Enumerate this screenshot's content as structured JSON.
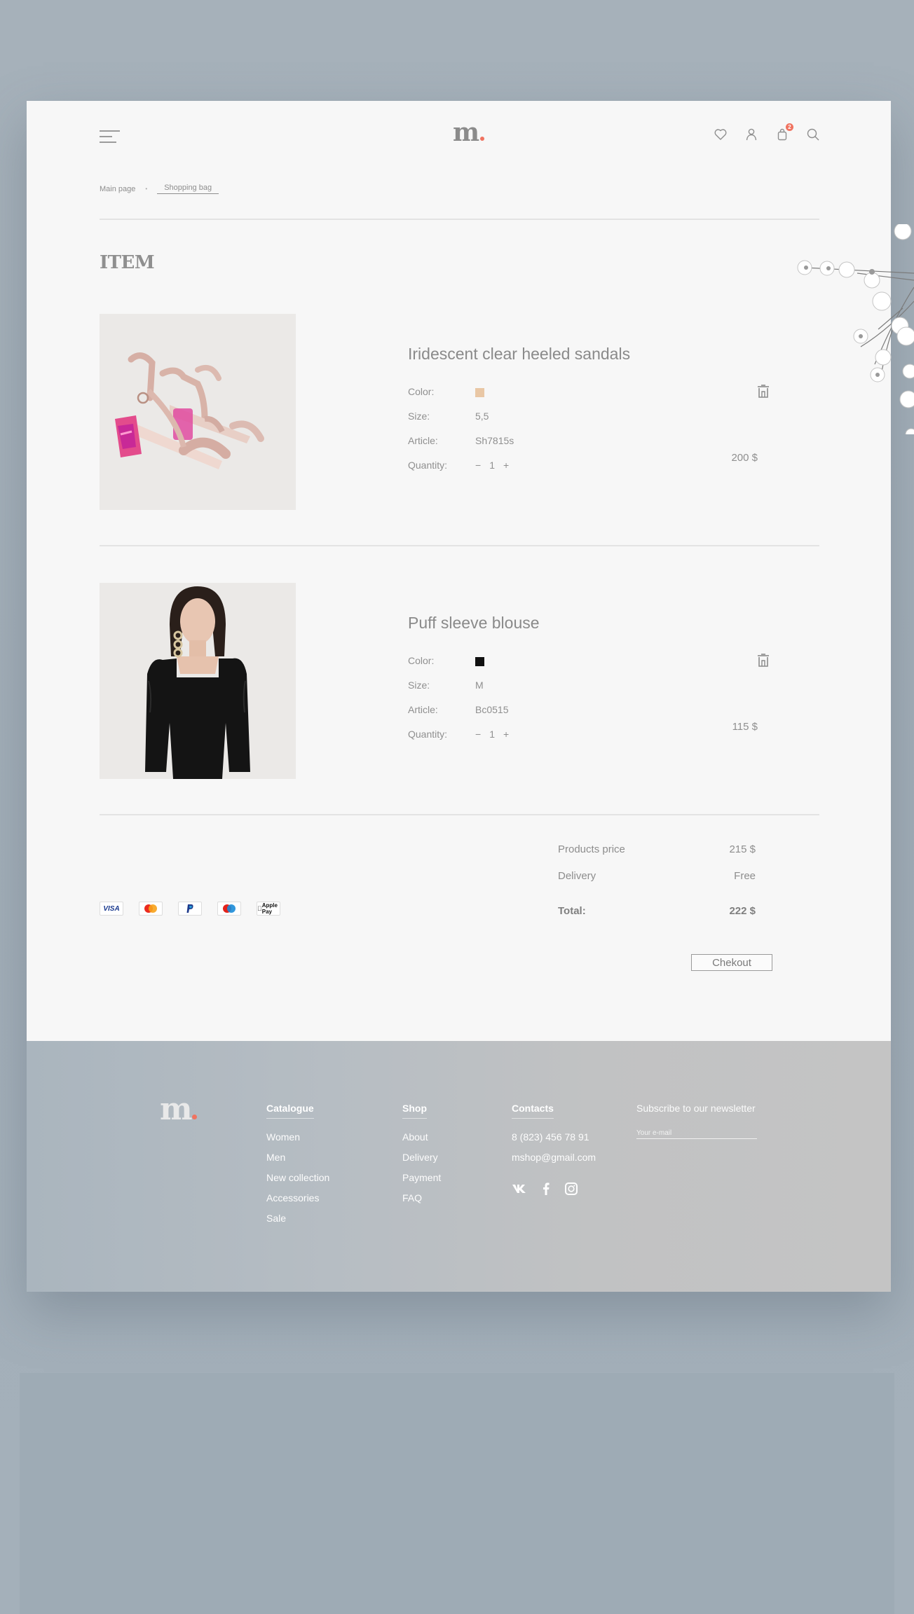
{
  "header": {
    "logo": "m",
    "cart_count": "2",
    "icons": [
      "menu-icon",
      "heart-icon",
      "user-icon",
      "bag-icon",
      "search-icon"
    ]
  },
  "breadcrumb": {
    "items": [
      "Main page",
      "Shopping bag"
    ],
    "separator": "•"
  },
  "section_title": "ITEM",
  "labels": {
    "color": "Color:",
    "size": "Size:",
    "article": "Article:",
    "quantity": "Quantity:",
    "minus": "−",
    "plus": "+"
  },
  "products": [
    {
      "name": "Iridescent clear heeled sandals",
      "color_hex": "#e9c7a5",
      "size": "5,5",
      "article": "Sh7815s",
      "quantity": "1",
      "price": "200 $"
    },
    {
      "name": "Puff sleeve blouse",
      "color_hex": "#111111",
      "size": "M",
      "article": "Bc0515",
      "quantity": "1",
      "price": "115 $"
    }
  ],
  "payment_methods": [
    "VISA",
    "Mastercard",
    "PayPal",
    "Maestro",
    "Apple Pay"
  ],
  "summary": {
    "products_price_label": "Products price",
    "products_price": "215 $",
    "delivery_label": "Delivery",
    "delivery": "Free",
    "total_label": "Total:",
    "total": "222 $",
    "checkout_label": "Chekout"
  },
  "footer": {
    "logo": "m",
    "catalogue": {
      "title": "Catalogue",
      "items": [
        "Women",
        "Men",
        "New collection",
        "Accessories",
        "Sale"
      ]
    },
    "shop": {
      "title": "Shop",
      "items": [
        "About",
        "Delivery",
        "Payment",
        "FAQ"
      ]
    },
    "contacts": {
      "title": "Contacts",
      "phone": "8 (823) 456 78 91",
      "email": "mshop@gmail.com",
      "socials": [
        "vk-icon",
        "facebook-icon",
        "instagram-icon"
      ]
    },
    "newsletter": {
      "title": "Subscribe to our newsletter",
      "placeholder": "Your e-mail",
      "value": ""
    }
  },
  "colors": {
    "accent": "#f07360",
    "page_bg": "#f7f7f7",
    "outer_bg": "#a5b1bb"
  }
}
